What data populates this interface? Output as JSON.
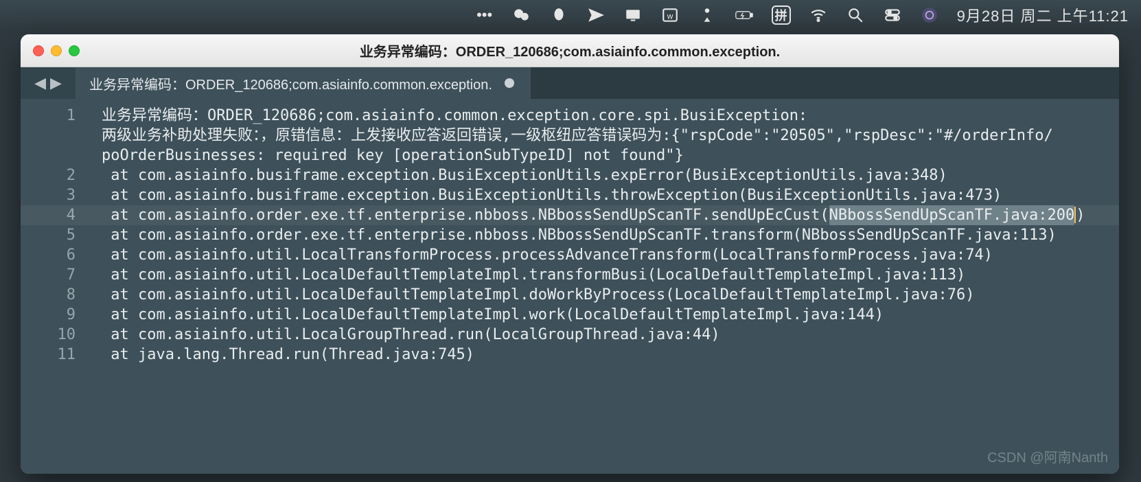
{
  "menubar": {
    "ime_label": "拼",
    "datetime": "9月28日 周二 上午11:21"
  },
  "window": {
    "title": "业务异常编码：ORDER_120686;com.asiainfo.common.exception."
  },
  "tab": {
    "label": "业务异常编码：ORDER_120686;com.asiainfo.common.exception."
  },
  "editor": {
    "highlighted_physical_row": 5,
    "gutter_rows": [
      {
        "num": "1",
        "span": 3
      },
      {
        "num": "2",
        "span": 1
      },
      {
        "num": "3",
        "span": 1
      },
      {
        "num": "4",
        "span": 1
      },
      {
        "num": "5",
        "span": 1
      },
      {
        "num": "6",
        "span": 1
      },
      {
        "num": "7",
        "span": 1
      },
      {
        "num": "8",
        "span": 1
      },
      {
        "num": "9",
        "span": 1
      },
      {
        "num": "10",
        "span": 1
      },
      {
        "num": "11",
        "span": 1
      }
    ],
    "physical_lines": [
      "业务异常编码：ORDER_120686;com.asiainfo.common.exception.core.spi.BusiException:",
      "两级业务补助处理失败：，原错信息：上发接收应答返回错误,一级枢纽应答错误码为:{\"rspCode\":\"20505\",\"rspDesc\":\"#/orderInfo/",
      "poOrderBusinesses: required key [operationSubTypeID] not found\"}",
      " at com.asiainfo.busiframe.exception.BusiExceptionUtils.expError(BusiExceptionUtils.java:348)",
      " at com.asiainfo.busiframe.exception.BusiExceptionUtils.throwException(BusiExceptionUtils.java:473)",
      " at com.asiainfo.order.exe.tf.enterprise.nbboss.NBbossSendUpScanTF.sendUpEcCust(",
      " at com.asiainfo.order.exe.tf.enterprise.nbboss.NBbossSendUpScanTF.transform(NBbossSendUpScanTF.java:113)",
      " at com.asiainfo.util.LocalTransformProcess.processAdvanceTransform(LocalTransformProcess.java:74)",
      " at com.asiainfo.util.LocalDefaultTemplateImpl.transformBusi(LocalDefaultTemplateImpl.java:113)",
      " at com.asiainfo.util.LocalDefaultTemplateImpl.doWorkByProcess(LocalDefaultTemplateImpl.java:76)",
      " at com.asiainfo.util.LocalDefaultTemplateImpl.work(LocalDefaultTemplateImpl.java:144)",
      " at com.asiainfo.util.LocalGroupThread.run(LocalGroupThread.java:44)",
      " at java.lang.Thread.run(Thread.java:745)"
    ],
    "line4_selection": "NBbossSendUpScanTF.java:200",
    "line4_tail": ")"
  },
  "watermark": "CSDN @阿南Nanth"
}
